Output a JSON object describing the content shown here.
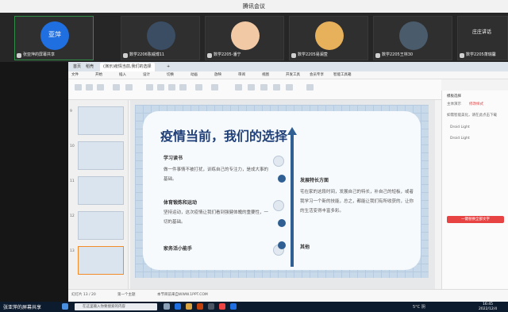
{
  "meeting": {
    "title": "腾讯会议",
    "participants": [
      {
        "avatar_text": "亚萍",
        "name": "张亚萍的屏幕共享",
        "avatar_color": "#1f6fe0",
        "text_color": "#ffffff",
        "active": true
      },
      {
        "name": "数学2206陈威博11",
        "avatar_color": "#3b4d63"
      },
      {
        "name": "数学2205-潘宁",
        "avatar_color": "#f2c9a5"
      },
      {
        "name": "数学2205易澜萱",
        "avatar_color": "#e7b05a"
      },
      {
        "name": "数学2205王林30",
        "avatar_color": "#4a5b6c"
      },
      {
        "name": "数学2205萧瑞馨",
        "avatar_text": "庄庄讲话",
        "avatar_color": "#3a3a3a"
      }
    ],
    "my_share_label": "张亚萍的屏幕共享"
  },
  "wps": {
    "tabs": [
      "首页",
      "稻壳",
      "(演示)疫情当前,我们的选择",
      "+"
    ],
    "menu": [
      "文件",
      "开始",
      "插入",
      "设计",
      "切换",
      "动画",
      "放映",
      "审阅",
      "视图",
      "开发工具",
      "会员专享",
      "智能工具箱"
    ],
    "slide": {
      "title": "疫情当前，我们的选择",
      "sections": [
        {
          "heading": "学习读书",
          "body": "做一件事情不被打扰，训练自己的专注力，是成大事的基础。"
        },
        {
          "heading": "体育锻炼和运动",
          "body": "坚持运动，这次疫情让我们看到强健体魄的重要性，一切的基础。"
        },
        {
          "heading": "家务活小能手"
        },
        {
          "heading": "发展特长方面",
          "body": "宅在家的这段时间，发展自己的特长，补自己的短板，或者我学习一个新的技能，总之，都能让我们有所收获的，让你的生活变得丰富多彩。"
        },
        {
          "heading": "其他"
        }
      ]
    },
    "right_panel": {
      "title": "模板选择",
      "tab1": "主体演示",
      "tab2": "修改样式",
      "hint": "如需智能美化，请在此点击下载",
      "font1": "Droid Light",
      "font2": "Droid Light",
      "button": "一键替换全部文字"
    },
    "status": {
      "page": "幻灯片 13 / 20",
      "theme": "第一个主题",
      "website": "本节目前来自WWW.1PPT.COM"
    }
  },
  "taskbar": {
    "search_placeholder": "在这里输入你要搜索的内容",
    "temp": "5°C 阴",
    "time": "16:45",
    "date": "2022/12/4"
  }
}
